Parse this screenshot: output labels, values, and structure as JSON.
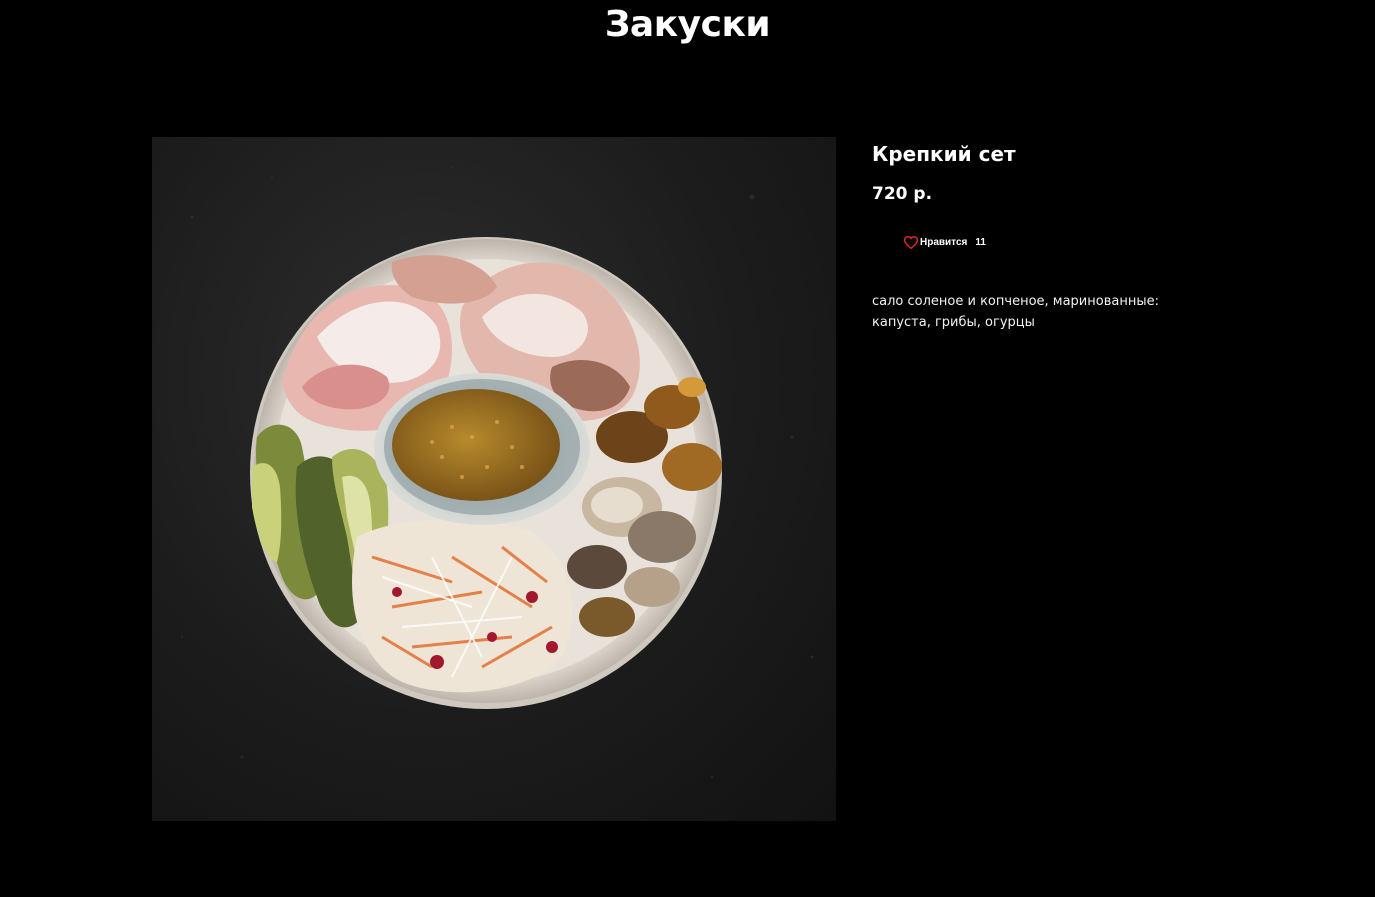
{
  "section": {
    "title": "Закуски"
  },
  "product": {
    "name": "Крепкий сет",
    "price": "720 р.",
    "likes": {
      "label": "Нравится",
      "count": "11"
    },
    "description": "сало соленое и копченое, маринованные: капуста, грибы, огурцы"
  },
  "colors": {
    "background": "#000000",
    "text": "#ffffff",
    "heart": "#e3262b"
  }
}
